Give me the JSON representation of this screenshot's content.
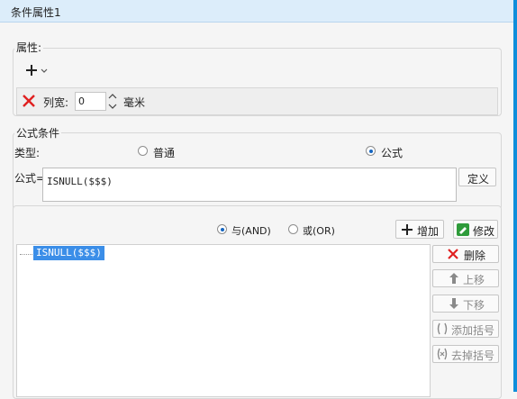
{
  "window": {
    "title": "条件属性1"
  },
  "properties": {
    "section_label": "属性:",
    "add_icon": "plus-dropdown-icon",
    "delete_icon": "red-x-icon",
    "column_width_label": "列宽:",
    "column_width_value": "0",
    "unit_label": "毫米"
  },
  "formula_condition": {
    "section_label": "公式条件",
    "type_label": "类型:",
    "type_options": [
      {
        "label": "普通",
        "checked": false
      },
      {
        "label": "公式",
        "checked": true
      }
    ],
    "formula_label": "公式=",
    "formula_value": "ISNULL($$$)",
    "define_button": "定义"
  },
  "condition_list": {
    "logic_options": [
      {
        "label": "与(AND)",
        "checked": true
      },
      {
        "label": "或(OR)",
        "checked": false
      }
    ],
    "add_button": "增加",
    "modify_button": "修改",
    "items": [
      "ISNULL($$$)"
    ],
    "selected_index": 0,
    "side_buttons": {
      "delete": "删除",
      "move_up": "上移",
      "move_down": "下移",
      "add_bracket": "添加括号",
      "remove_bracket": "去掉括号"
    }
  },
  "colors": {
    "title_bg": "#dcedfa",
    "accent": "#0f8edb",
    "selection": "#3b8ee8",
    "delete_red": "#e02020",
    "modify_green": "#2e9b3a"
  }
}
